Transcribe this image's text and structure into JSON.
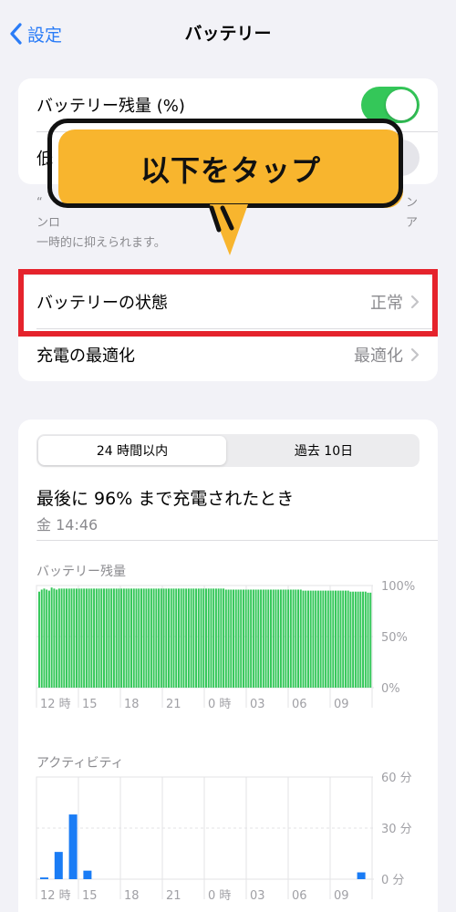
{
  "nav": {
    "back_label": "設定",
    "title": "バッテリー"
  },
  "settings": {
    "battery_percentage": {
      "label": "バッテリー残量 (%)",
      "on": true
    },
    "low_power_mode": {
      "label": "低",
      "on": false
    },
    "footnote_line1": "“",
    "footnote_line1_end": "ン",
    "footnote_line2": "ンロ",
    "footnote_line2_end": "ア",
    "footnote_line3": "一時的に抑えられます。"
  },
  "callout": {
    "text": "以下をタップ",
    "color": "#f8b52e",
    "outline_color": "#111111",
    "highlight_color": "#e5232c"
  },
  "health": {
    "battery_health": {
      "label": "バッテリーの状態",
      "value": "正常"
    },
    "charging_optimization": {
      "label": "充電の最適化",
      "value": "最適化"
    }
  },
  "usage": {
    "tabs": [
      {
        "label": "24 時間以内",
        "active": true
      },
      {
        "label": "過去 10日",
        "active": false
      }
    ],
    "last_charge": "最後に 96% まで充電されたとき",
    "last_charge_time": "金 14:46"
  },
  "chart_data": [
    {
      "type": "bar",
      "title": "バッテリー残量",
      "series_color": "#34c759",
      "ylim": [
        0,
        100
      ],
      "yticks": [
        "100%",
        "50%",
        "0%"
      ],
      "xticks": [
        "12 時",
        "15",
        "18",
        "21",
        "0 時",
        "03",
        "06",
        "09"
      ],
      "values": [
        94,
        96,
        97,
        96,
        95,
        98,
        97,
        96,
        97,
        97,
        97,
        97,
        97,
        97,
        97,
        97,
        97,
        97,
        97,
        97,
        97,
        97,
        97,
        97,
        97,
        97,
        97,
        97,
        97,
        97,
        97,
        97,
        97,
        97,
        97,
        97,
        97,
        97,
        97,
        97,
        97,
        97,
        97,
        97,
        97,
        97,
        97,
        97,
        97,
        97,
        97,
        97,
        97,
        97,
        97,
        97,
        97,
        97,
        97,
        97,
        97,
        97,
        97,
        97,
        97,
        97,
        97,
        97,
        97,
        97,
        97,
        97,
        97,
        97,
        97,
        96,
        96,
        96,
        96,
        96,
        96,
        96,
        96,
        96,
        96,
        96,
        96,
        96,
        96,
        96,
        96,
        96,
        96,
        96,
        96,
        96,
        96,
        96,
        96,
        96,
        96,
        96,
        96,
        96,
        96,
        96,
        95,
        95,
        95,
        95,
        95,
        95,
        95,
        95,
        95,
        95,
        95,
        95,
        95,
        95,
        95,
        95,
        95,
        95,
        95,
        94,
        94,
        94,
        94,
        94,
        94,
        94,
        93,
        93
      ]
    },
    {
      "type": "bar",
      "title": "アクティビティ",
      "series_color": "#1a7cf5",
      "ylim": [
        0,
        60
      ],
      "yticks": [
        "60 分",
        "30 分",
        "0 分"
      ],
      "xticks": [
        "12 時",
        "15",
        "18",
        "21",
        "0 時",
        "03",
        "06",
        "09"
      ],
      "values": [
        1,
        16,
        38,
        5,
        0,
        0,
        0,
        0,
        0,
        0,
        0,
        0,
        0,
        0,
        0,
        0,
        0,
        0,
        0,
        0,
        0,
        0,
        4
      ]
    }
  ]
}
